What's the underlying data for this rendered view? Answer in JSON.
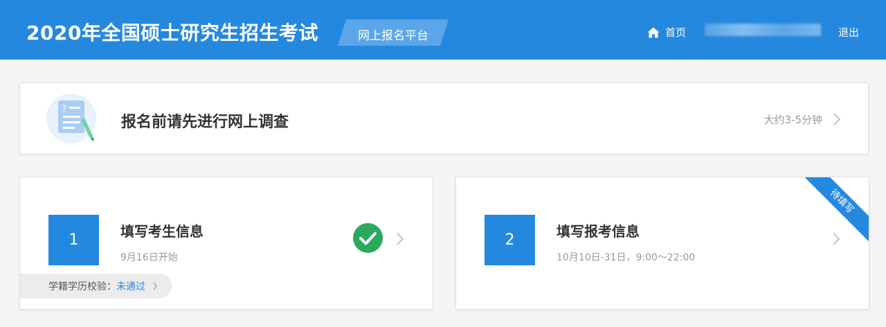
{
  "header": {
    "title": "2020年全国硕士研究生招生考试",
    "platform_tag": "网上报名平台",
    "home_label": "首页",
    "logout_label": "退出"
  },
  "survey": {
    "title": "报名前请先进行网上调查",
    "time_estimate": "大约3-5分钟"
  },
  "steps": [
    {
      "number": "1",
      "title": "填写考生信息",
      "time": "9月16日开始",
      "status": "completed",
      "verification": {
        "label": "学籍学历校验：",
        "value": "未通过"
      }
    },
    {
      "number": "2",
      "title": "填写报考信息",
      "time": "10月10日-31日，9:00～22:00",
      "badge": "待填写"
    }
  ],
  "colors": {
    "primary": "#2588df",
    "success": "#2aaa5e",
    "muted": "#999999"
  },
  "icons": [
    "home-icon",
    "survey-document-icon",
    "chevron-right-icon",
    "check-circle-icon"
  ]
}
